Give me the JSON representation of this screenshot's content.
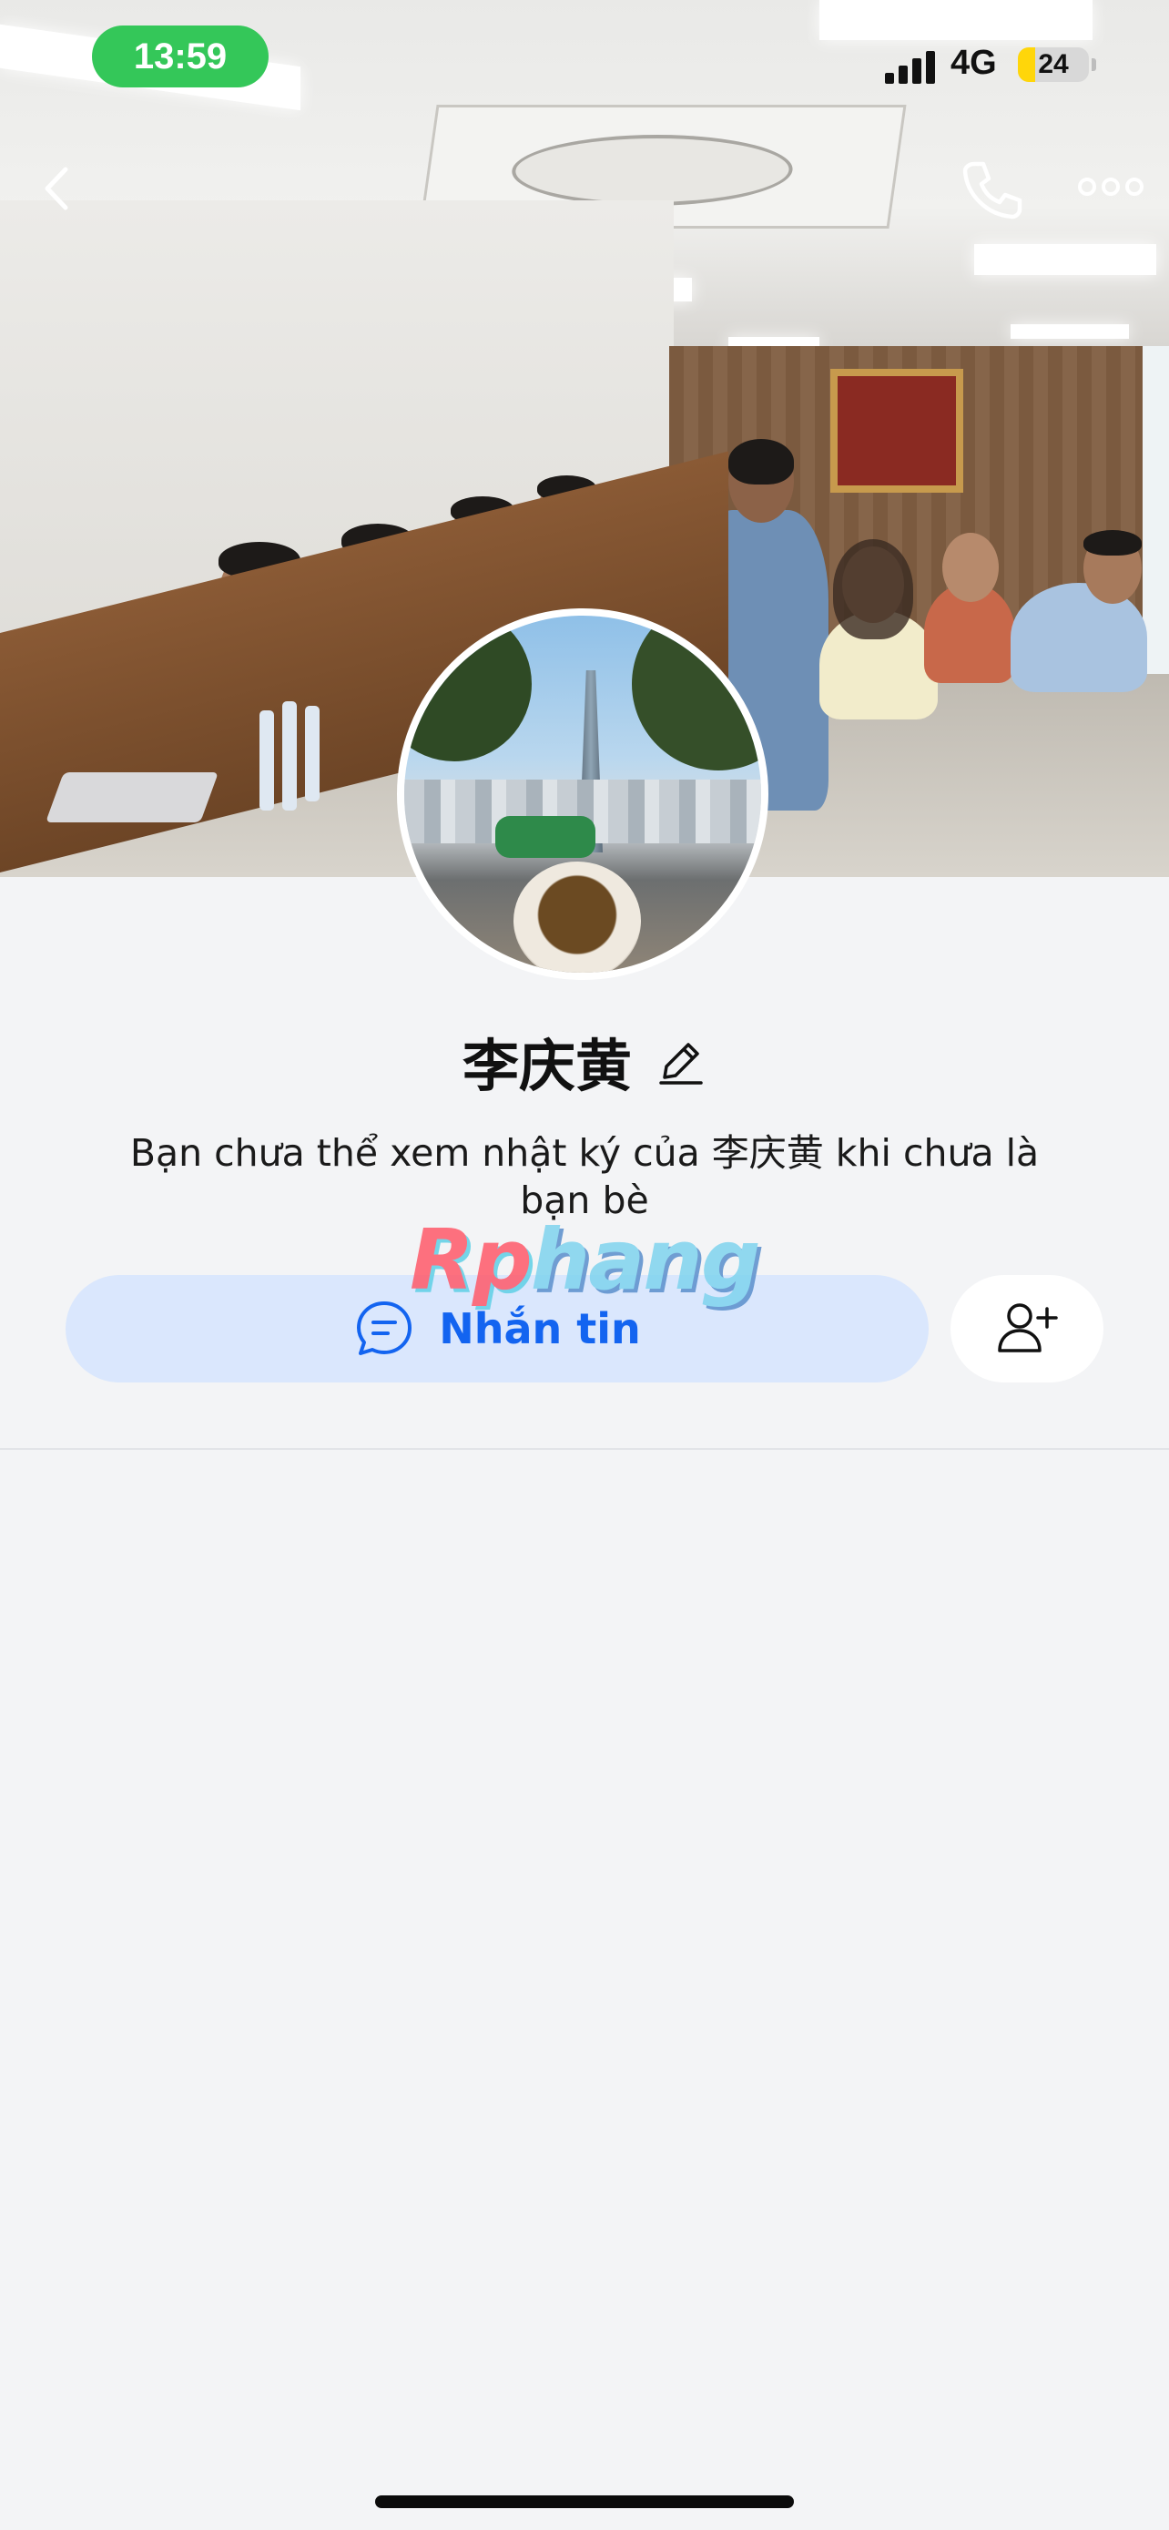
{
  "status_bar": {
    "time": "13:59",
    "network": "4G",
    "battery": "24",
    "battery_fraction": 0.24
  },
  "nav": {
    "back_icon": "chevron-left-icon",
    "call_icon": "phone-icon",
    "more_icon": "more-horizontal-icon"
  },
  "profile": {
    "name": "李庆黄",
    "edit_icon": "pencil-icon",
    "notice": "Bạn chưa thể xem nhật ký của 李庆黄 khi chưa là bạn bè"
  },
  "watermark": {
    "part1": "Rp",
    "part2": "hang"
  },
  "actions": {
    "message_label": "Nhắn tin",
    "message_icon": "chat-bubble-icon",
    "add_friend_icon": "add-user-icon"
  },
  "colors": {
    "accent": "#1364f0",
    "accent_bg": "#dae7fd",
    "time_pill": "#34c759",
    "page_bg": "#f3f4f6"
  }
}
